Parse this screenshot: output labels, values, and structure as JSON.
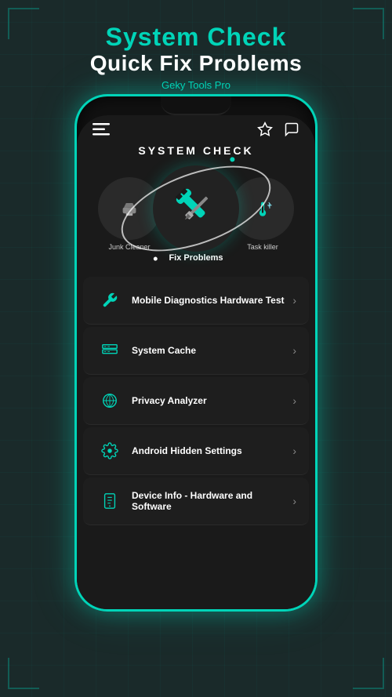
{
  "header": {
    "title_cyan": "System Check",
    "title_white": "Quick Fix Problems",
    "subtitle": "Geky Tools Pro"
  },
  "phone": {
    "nav": {
      "menu_icon": "≡",
      "star_icon": "☆",
      "chat_icon": "💬"
    },
    "system_check": {
      "title": "SYSTEM CHECK",
      "icons": [
        {
          "label": "Junk Cleaner",
          "side": "left"
        },
        {
          "label": "Fix Problems",
          "center": true
        },
        {
          "label": "Task killer",
          "side": "right"
        }
      ]
    },
    "menu_items": [
      {
        "id": "diagnostics",
        "label": "Mobile Diagnostics Hardware Test"
      },
      {
        "id": "cache",
        "label": "System Cache"
      },
      {
        "id": "privacy",
        "label": "Privacy Analyzer"
      },
      {
        "id": "hidden",
        "label": "Android Hidden Settings"
      },
      {
        "id": "device",
        "label": "Device Info - Hardware and Software"
      }
    ]
  },
  "colors": {
    "accent": "#00d4b8",
    "bg_dark": "#1a1a1a",
    "text_white": "#ffffff",
    "text_gray": "#cccccc"
  }
}
